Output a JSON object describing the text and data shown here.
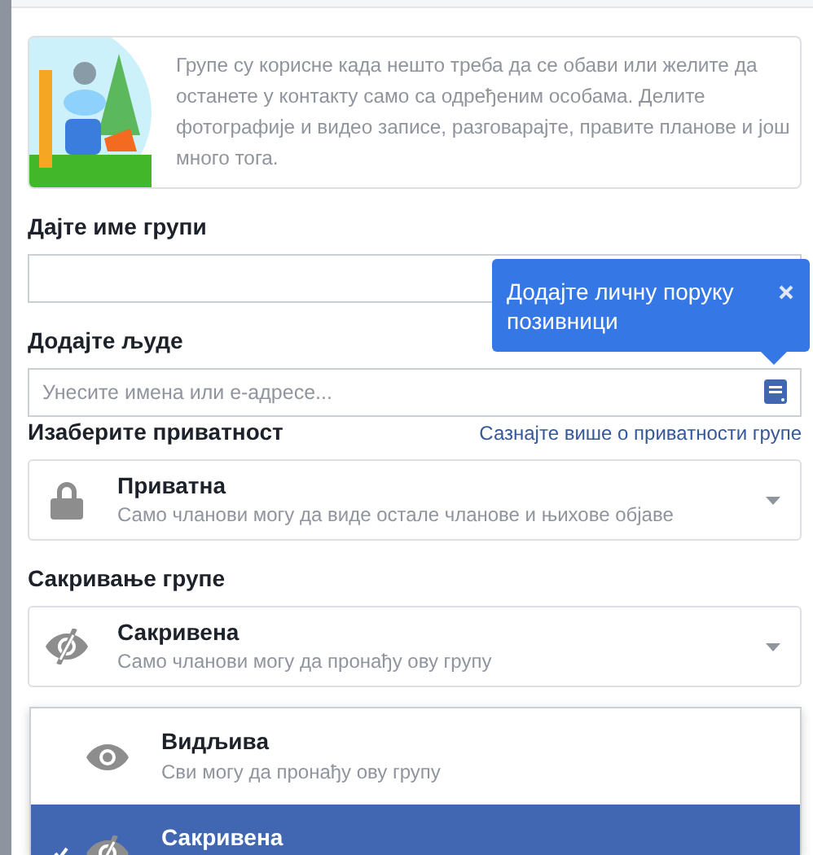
{
  "intro": {
    "text": "Групе су корисне када нешто треба да се обави или желите да останете у контакту само са одређеним особама. Делите фотографије и видео записе, разговарајте, правите планове и још много тога."
  },
  "name_field": {
    "label": "Дајте име групи"
  },
  "people_field": {
    "label": "Додајте људе",
    "placeholder": "Унесите имена или е-адресе..."
  },
  "tooltip": {
    "text": "Додајте личну поруку позивници"
  },
  "privacy": {
    "heading": "Изаберите приватност",
    "link": "Сазнајте више о приватности групе",
    "current": {
      "kind": "lock",
      "title": "Приватна",
      "description": "Само чланови могу да виде остале чланове и њихове објаве"
    }
  },
  "hiding": {
    "heading": "Сакривање групе",
    "current": {
      "kind": "hidden",
      "title": "Сакривена",
      "description": "Само чланови могу да пронађу ову групу"
    },
    "options": [
      {
        "kind": "eye",
        "title": "Видљива",
        "description": "Сви могу да пронађу ову групу",
        "selected": false
      },
      {
        "kind": "hidden",
        "title": "Сакривена",
        "selected": true
      }
    ]
  }
}
